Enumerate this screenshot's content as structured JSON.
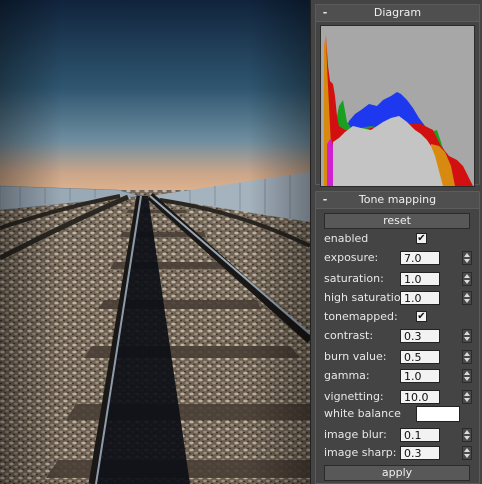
{
  "diagram": {
    "header": "Diagram",
    "collapse_glyph": "-"
  },
  "tone_mapping": {
    "header": "Tone mapping",
    "collapse_glyph": "-",
    "reset_label": "reset",
    "apply_label": "apply",
    "check_glyph": "✔",
    "enabled": {
      "label": "enabled",
      "checked": true
    },
    "exposure": {
      "label": "exposure:",
      "value": "7.0"
    },
    "saturation": {
      "label": "saturation:",
      "value": "1.0"
    },
    "high_saturation": {
      "label": "high saturation:",
      "value": "1.0"
    },
    "tonemapped": {
      "label": "tonemapped:",
      "checked": true
    },
    "contrast": {
      "label": "contrast:",
      "value": "0.3"
    },
    "burn_value": {
      "label": "burn value:",
      "value": "0.5"
    },
    "gamma": {
      "label": "gamma:",
      "value": "1.0"
    },
    "vignetting": {
      "label": "vignetting:",
      "value": "10.0"
    },
    "white_balance": {
      "label": "white balance",
      "color": "#ffffff"
    },
    "image_blur": {
      "label": "image blur:",
      "value": "0.1"
    },
    "image_sharp": {
      "label": "image sharp:",
      "value": "0.3"
    }
  }
}
